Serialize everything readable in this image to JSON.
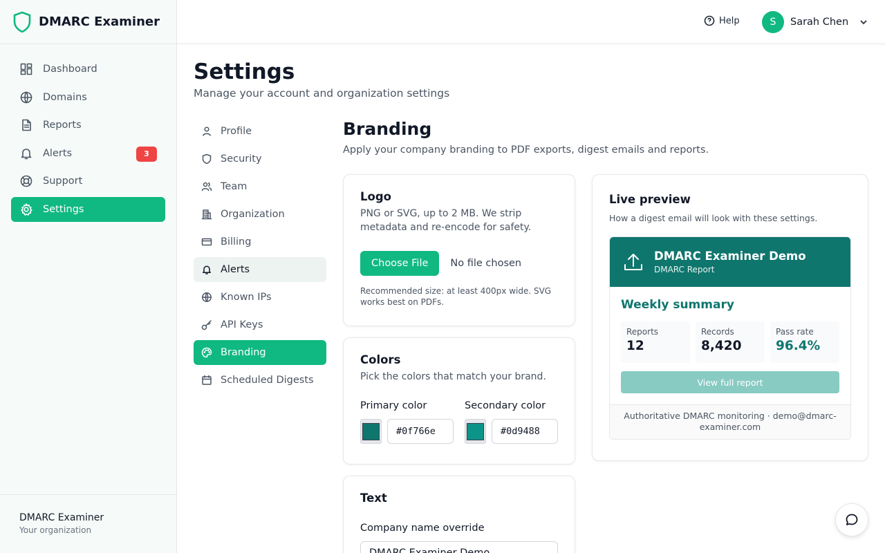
{
  "app": {
    "name": "DMARC Examiner"
  },
  "sidebar": {
    "items": [
      {
        "label": "Dashboard",
        "icon": "dashboard-icon"
      },
      {
        "label": "Domains",
        "icon": "globe-icon"
      },
      {
        "label": "Reports",
        "icon": "document-icon"
      },
      {
        "label": "Alerts",
        "icon": "bell-icon",
        "badge": "3"
      },
      {
        "label": "Support",
        "icon": "lifebuoy-icon"
      },
      {
        "label": "Settings",
        "icon": "gear-icon",
        "active": true
      }
    ],
    "org_name": "DMARC Examiner",
    "org_sub": "Your organization"
  },
  "topbar": {
    "help_label": "Help",
    "user_initial": "S",
    "user_name": "Sarah Chen"
  },
  "page": {
    "title": "Settings",
    "subtitle": "Manage your account and organization settings"
  },
  "settings_nav": [
    {
      "label": "Profile",
      "icon": "user-icon"
    },
    {
      "label": "Security",
      "icon": "shield-icon"
    },
    {
      "label": "Team",
      "icon": "users-icon"
    },
    {
      "label": "Organization",
      "icon": "building-icon"
    },
    {
      "label": "Billing",
      "icon": "credit-card-icon"
    },
    {
      "label": "Alerts",
      "icon": "bell-icon",
      "hovered": true
    },
    {
      "label": "Known IPs",
      "icon": "globe-icon"
    },
    {
      "label": "API Keys",
      "icon": "key-icon"
    },
    {
      "label": "Branding",
      "icon": "palette-icon",
      "active": true
    },
    {
      "label": "Scheduled Digests",
      "icon": "calendar-icon"
    }
  ],
  "branding": {
    "title": "Branding",
    "subtitle": "Apply your company branding to PDF exports, digest emails and reports.",
    "logo": {
      "title": "Logo",
      "desc": "PNG or SVG, up to 2 MB. We strip metadata and re-encode for safety.",
      "choose_label": "Choose File",
      "no_file_label": "No file chosen",
      "hint": "Recommended size: at least 400px wide. SVG works best on PDFs."
    },
    "colors": {
      "title": "Colors",
      "desc": "Pick the colors that match your brand.",
      "primary_label": "Primary color",
      "primary_value": "#0f766e",
      "secondary_label": "Secondary color",
      "secondary_value": "#0d9488"
    },
    "text": {
      "title": "Text",
      "company_label": "Company name override",
      "company_value": "DMARC Examiner Demo"
    }
  },
  "preview": {
    "title": "Live preview",
    "desc": "How a digest email will look with these settings.",
    "email_title": "DMARC Examiner Demo",
    "email_sub": "DMARC Report",
    "summary_title": "Weekly summary",
    "stats": [
      {
        "label": "Reports",
        "value": "12"
      },
      {
        "label": "Records",
        "value": "8,420"
      },
      {
        "label": "Pass rate",
        "value": "96.4%"
      }
    ],
    "button_label": "View full report",
    "footer": "Authoritative DMARC monitoring · demo@dmarc-examiner.com"
  },
  "colors": {
    "accent": "#10b981",
    "brand_primary": "#0f766e",
    "brand_secondary": "#0d9488",
    "badge": "#ef4444"
  }
}
